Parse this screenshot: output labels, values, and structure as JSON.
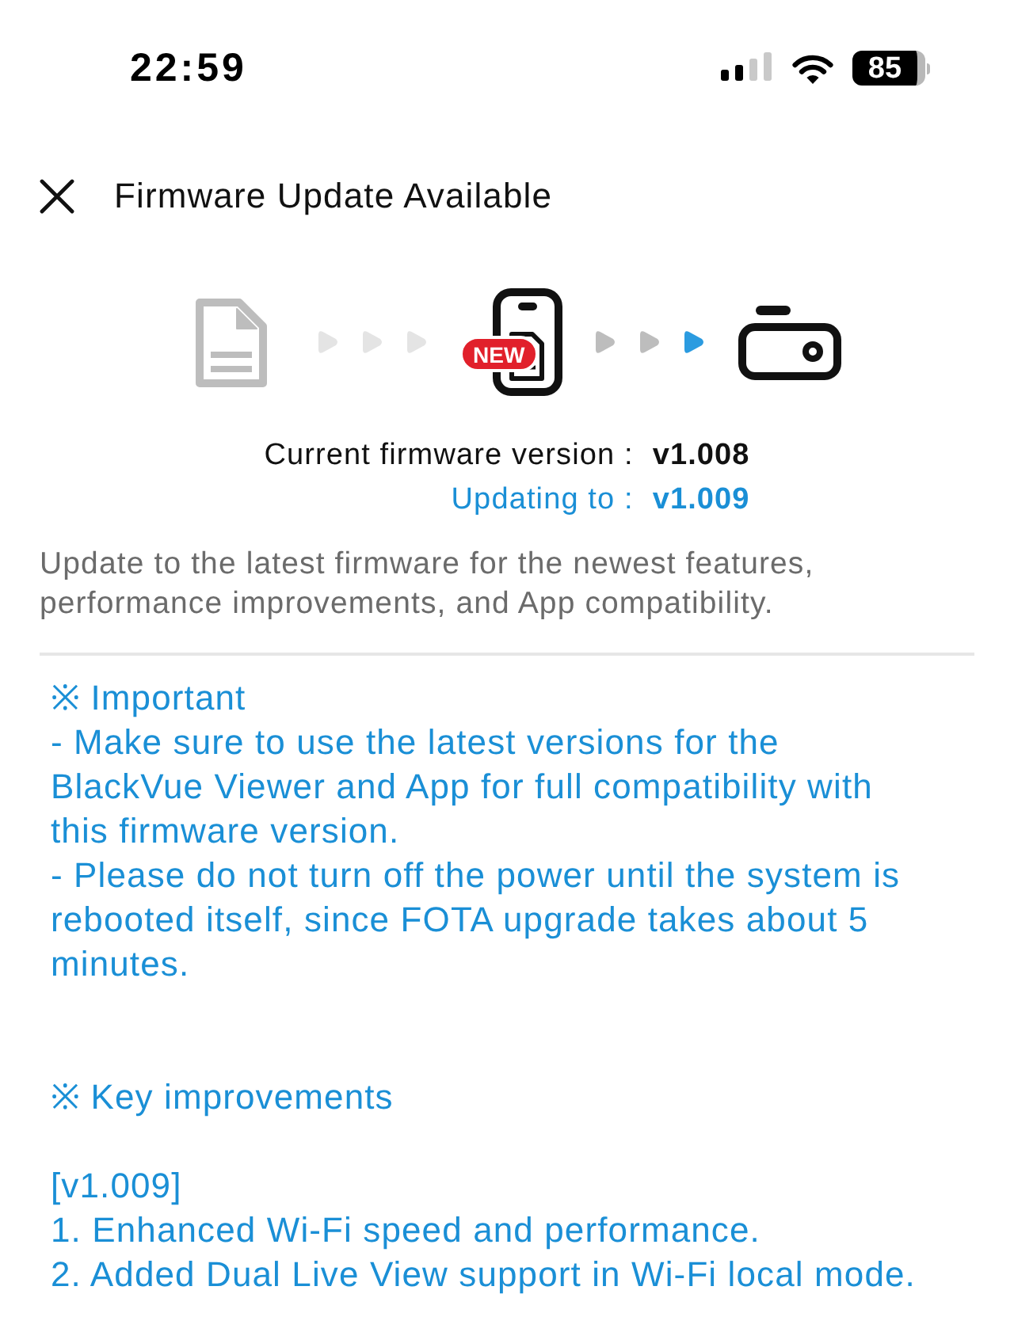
{
  "status_bar": {
    "time": "22:59",
    "battery": "85"
  },
  "header": {
    "title": "Firmware Update Available"
  },
  "update_flow": {
    "badge": "NEW",
    "arrows_to_phone": [
      {
        "color": "#e4e4e4"
      },
      {
        "color": "#e4e4e4"
      },
      {
        "color": "#e4e4e4"
      }
    ],
    "arrows_to_camera": [
      {
        "color": "#bdbdbd"
      },
      {
        "color": "#bdbdbd"
      },
      {
        "color": "#2b9be0"
      }
    ]
  },
  "versions": [
    {
      "kind": "current",
      "label": "Current firmware version :",
      "value": "v1.008"
    },
    {
      "kind": "target",
      "label": "Updating to :",
      "value": "v1.009"
    }
  ],
  "description": "Update to the latest firmware for the newest features, performance improvements, and App compatibility.",
  "notes": [
    {
      "heading": "※ Important",
      "lines": [
        "- Make sure to use the latest versions for the BlackVue Viewer and App for full compatibility with this firmware version.",
        "- Please do not turn off the power until the system is rebooted itself, since FOTA upgrade takes about 5 minutes."
      ]
    },
    {
      "heading": "※ Key improvements",
      "version": "[v1.009]",
      "lines": [
        "1. Enhanced Wi-Fi speed and performance.",
        "2. Added Dual Live View support in Wi-Fi local mode."
      ]
    }
  ]
}
